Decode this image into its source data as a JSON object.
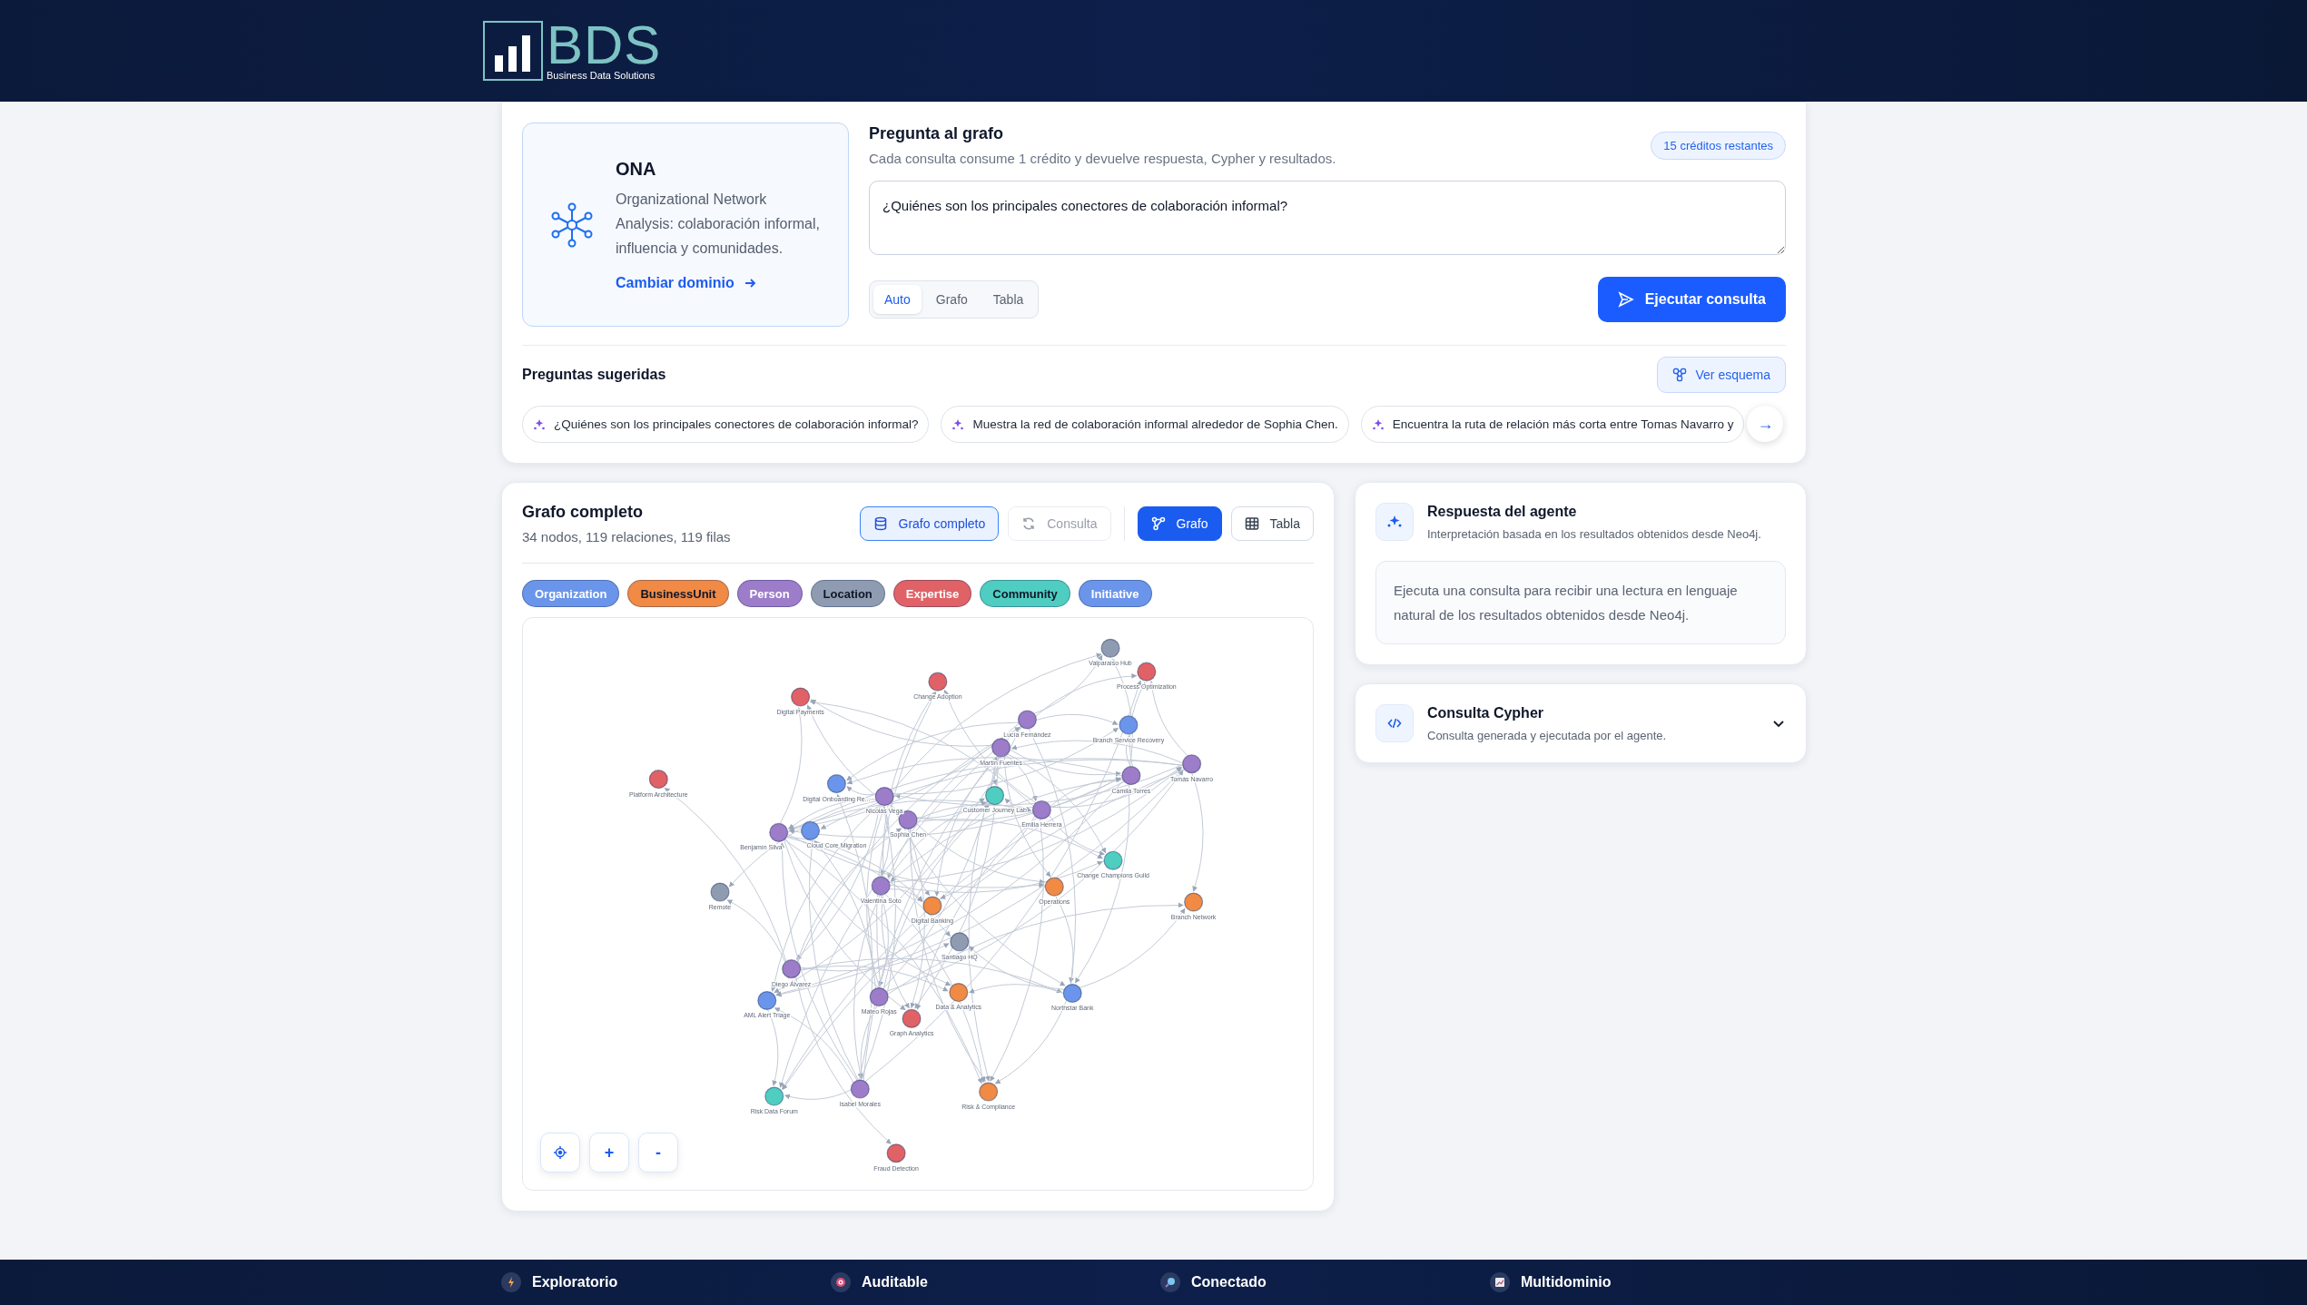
{
  "header": {
    "logo_text": "BDS",
    "logo_tagline": "Business Data Solutions"
  },
  "domain": {
    "title": "ONA",
    "description": "Organizational Network Analysis: colaboración informal, influencia y comunidades.",
    "link": "Cambiar dominio"
  },
  "query": {
    "title": "Pregunta al grafo",
    "subtitle": "Cada consulta consume 1 crédito y devuelve respuesta, Cypher y resultados.",
    "credits": "15 créditos restantes",
    "value": "¿Quiénes son los principales conectores de colaboración informal?",
    "modes": [
      {
        "label": "Auto",
        "selected": true
      },
      {
        "label": "Grafo",
        "selected": false
      },
      {
        "label": "Tabla",
        "selected": false
      }
    ],
    "run_button": "Ejecutar consulta"
  },
  "suggestions": {
    "title": "Preguntas sugeridas",
    "schema_button": "Ver esquema",
    "next_button": "→",
    "items": [
      "¿Quiénes son los principales conectores de colaboración informal?",
      "Muestra la red de colaboración informal alrededor de Sophia Chen.",
      "Encuentra la ruta de relación más corta entre Tomas Navarro y"
    ]
  },
  "graph": {
    "title": "Grafo completo",
    "summary": "34 nodos, 119 relaciones, 119 filas",
    "source_toggle": [
      {
        "label": "Grafo completo",
        "kind": "database",
        "selected": true,
        "disabled": false
      },
      {
        "label": "Consulta",
        "kind": "refresh",
        "selected": false,
        "disabled": true
      }
    ],
    "view_toggle": [
      {
        "label": "Grafo",
        "kind": "graph",
        "selected": true
      },
      {
        "label": "Tabla",
        "kind": "table",
        "selected": false
      }
    ],
    "legend": [
      {
        "label": "Organization",
        "color": "#6a95ea"
      },
      {
        "label": "BusinessUnit",
        "color": "#f08a45"
      },
      {
        "label": "Person",
        "color": "#9d7cc9"
      },
      {
        "label": "Location",
        "color": "#8f9bb0"
      },
      {
        "label": "Expertise",
        "color": "#e06266"
      },
      {
        "label": "Community",
        "color": "#4fcdc0"
      },
      {
        "label": "Initiative",
        "color": "#6a95ea"
      }
    ],
    "nodes": [
      {
        "label": "Valparaíso Hub",
        "color": "#8f9bb0"
      },
      {
        "label": "Process Optimization",
        "color": "#e06266"
      },
      {
        "label": "Change Adoption",
        "color": "#e06266"
      },
      {
        "label": "Digital Payments",
        "color": "#e06266"
      },
      {
        "label": "Lucía Fernández",
        "color": "#9d7cc9"
      },
      {
        "label": "Branch Service Recovery",
        "color": "#6a95ea"
      },
      {
        "label": "Martín Fuentes",
        "color": "#9d7cc9"
      },
      {
        "label": "Tomás Navarro",
        "color": "#9d7cc9"
      },
      {
        "label": "Camila Torres",
        "color": "#9d7cc9"
      },
      {
        "label": "Platform Architecture",
        "color": "#e06266"
      },
      {
        "label": "Digital Onboarding Re...",
        "color": "#6a95ea"
      },
      {
        "label": "Nicolás Vega",
        "color": "#9d7cc9"
      },
      {
        "label": "Customer Journey Lab",
        "color": "#4fcdc0"
      },
      {
        "label": "Emilia Herrera",
        "color": "#9d7cc9"
      },
      {
        "label": "Sophia Chen",
        "color": "#9d7cc9"
      },
      {
        "label": "Benjamín Silva",
        "color": "#9d7cc9"
      },
      {
        "label": "Cloud Core Migration",
        "color": "#6a95ea"
      },
      {
        "label": "Change Champions Guild",
        "color": "#4fcdc0"
      },
      {
        "label": "Operations",
        "color": "#f08a45"
      },
      {
        "label": "Remote",
        "color": "#8f9bb0"
      },
      {
        "label": "Valentina Soto",
        "color": "#9d7cc9"
      },
      {
        "label": "Branch Network",
        "color": "#f08a45"
      },
      {
        "label": "Digital Banking",
        "color": "#f08a45"
      },
      {
        "label": "Santiago HQ",
        "color": "#8f9bb0"
      },
      {
        "label": "Diego Álvarez",
        "color": "#9d7cc9"
      },
      {
        "label": "AML Alert Triage",
        "color": "#6a95ea"
      },
      {
        "label": "Mateo Rojas",
        "color": "#9d7cc9"
      },
      {
        "label": "Graph Analytics",
        "color": "#e06266"
      },
      {
        "label": "Data & Analytics",
        "color": "#f08a45"
      },
      {
        "label": "Northstar Bank",
        "color": "#6a95ea"
      },
      {
        "label": "Risk Data Forum",
        "color": "#4fcdc0"
      },
      {
        "label": "Isabel Morales",
        "color": "#9d7cc9"
      },
      {
        "label": "Risk & Compliance",
        "color": "#f08a45"
      },
      {
        "label": "Fraud Detection",
        "color": "#e06266"
      }
    ],
    "controls": [
      "+",
      "-"
    ]
  },
  "agent": {
    "title": "Respuesta del agente",
    "subtitle": "Interpretación basada en los resultados obtenidos desde Neo4j.",
    "message": "Ejecuta una consulta para recibir una lectura en lenguaje natural de los resultados obtenidos desde Neo4j."
  },
  "cypher": {
    "title": "Consulta Cypher",
    "subtitle": "Consulta generada y ejecutada por el agente.",
    "expanded": false
  },
  "footer": [
    {
      "label": "Exploratorio",
      "kind": "bolt"
    },
    {
      "label": "Auditable",
      "kind": "target"
    },
    {
      "label": "Conectado",
      "kind": "search"
    },
    {
      "label": "Multidominio",
      "kind": "chart"
    }
  ]
}
